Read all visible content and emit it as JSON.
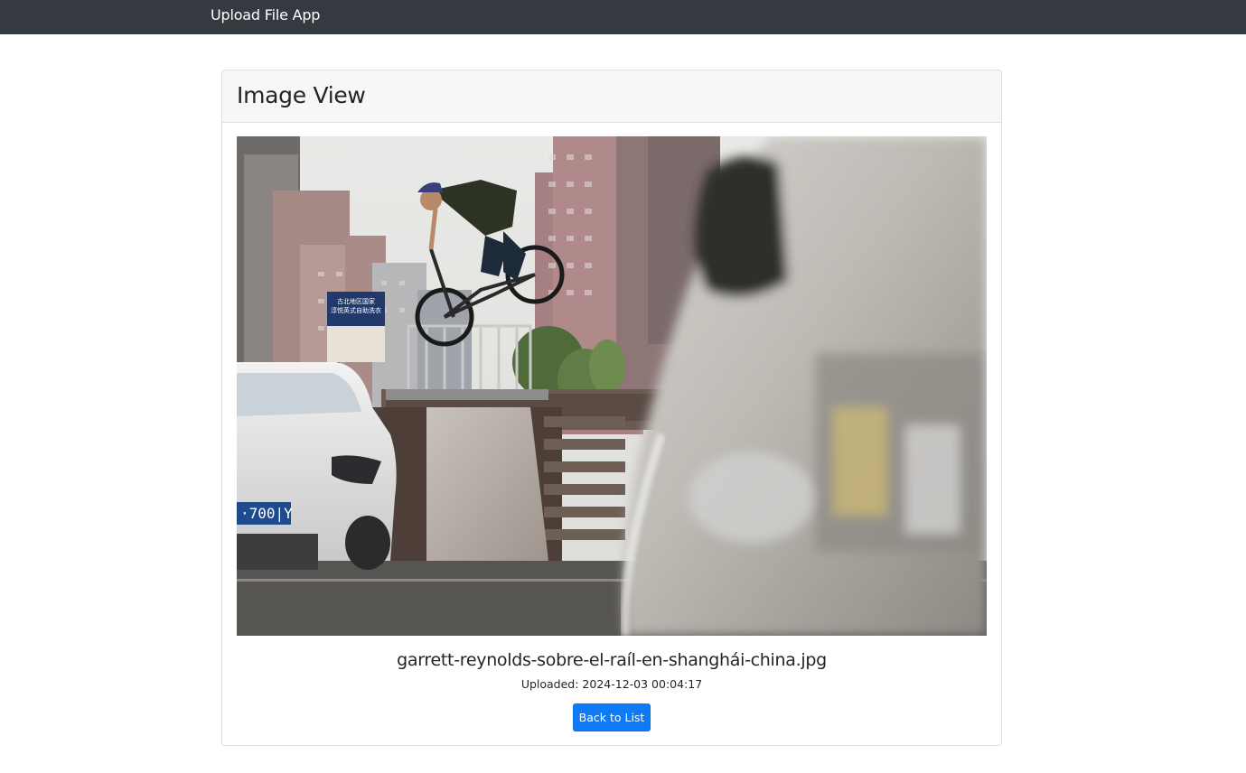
{
  "navbar": {
    "brand": "Upload File App"
  },
  "card": {
    "title": "Image View"
  },
  "image": {
    "filename": "garrett-reynolds-sobre-el-raíl-en-shanghái-china.jpg",
    "uploaded_text": "Uploaded: 2024-12-03 00:04:17",
    "sign_text": "古北地区国家 淳悦英式自助洗衣",
    "plate_text": "·700|Y"
  },
  "actions": {
    "back_label": "Back to List"
  },
  "colors": {
    "navbar_bg": "#343a40",
    "button_bg": "#0d7bf7",
    "card_header_bg": "#f7f7f7"
  }
}
